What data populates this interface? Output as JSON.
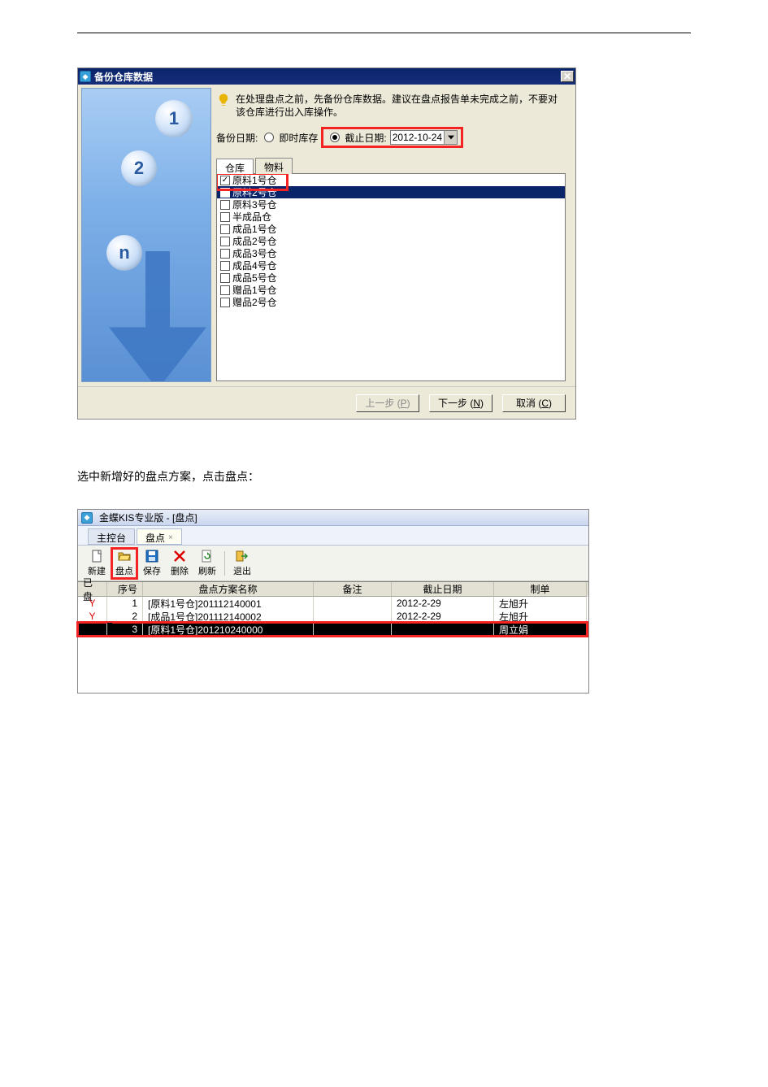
{
  "dialog1": {
    "title": "备份仓库数据",
    "hint": "在处理盘点之前，先备份仓库数据。建议在盘点报告单未完成之前，不要对该仓库进行出入库操作。",
    "backup_label": "备份日期:",
    "radio_now": "即时库存",
    "radio_cutoff": "截止日期:",
    "cutoff_value": "2012-10-24",
    "tab_warehouse": "仓库",
    "tab_material": "物料",
    "items": [
      {
        "label": "原料1号仓",
        "checked": true
      },
      {
        "label": "原料2号仓",
        "checked": false,
        "selected": true
      },
      {
        "label": "原料3号仓",
        "checked": false
      },
      {
        "label": "半成品仓",
        "checked": false
      },
      {
        "label": "成品1号仓",
        "checked": false
      },
      {
        "label": "成品2号仓",
        "checked": false
      },
      {
        "label": "成品3号仓",
        "checked": false
      },
      {
        "label": "成品4号仓",
        "checked": false
      },
      {
        "label": "成品5号仓",
        "checked": false
      },
      {
        "label": "赠品1号仓",
        "checked": false
      },
      {
        "label": "赠品2号仓",
        "checked": false
      }
    ],
    "btn_prev_pre": "上一步 (",
    "btn_prev_key": "P",
    "btn_prev_post": ")",
    "btn_next_pre": "下一步 (",
    "btn_next_key": "N",
    "btn_next_post": ")",
    "btn_cancel_pre": "取消 (",
    "btn_cancel_key": "C",
    "btn_cancel_post": ")"
  },
  "midtext": "选中新增好的盘点方案，点击盘点：",
  "app2": {
    "title": "金蝶KIS专业版 - [盘点]",
    "tab_console": "主控台",
    "tab_pd": "盘点",
    "toolbar": {
      "new": "新建",
      "pd": "盘点",
      "save": "保存",
      "del": "删除",
      "refresh": "刷新",
      "exit": "退出"
    },
    "headers": {
      "yp": "已盘",
      "xh": "序号",
      "name": "盘点方案名称",
      "bz": "备注",
      "jz": "截止日期",
      "zd": "制单"
    },
    "rows": [
      {
        "yp": "Y",
        "xh": "1",
        "name": "[原料1号仓]201112140001",
        "bz": "",
        "jz": "2012-2-29",
        "zd": "左旭升"
      },
      {
        "yp": "Y",
        "xh": "2",
        "name": "[成品1号仓]201112140002",
        "bz": "",
        "jz": "2012-2-29",
        "zd": "左旭升"
      },
      {
        "yp": "",
        "xh": "3",
        "name": "[原料1号仓]201210240000",
        "bz": "",
        "jz": "",
        "zd": "周立娟",
        "selected": true
      }
    ]
  }
}
